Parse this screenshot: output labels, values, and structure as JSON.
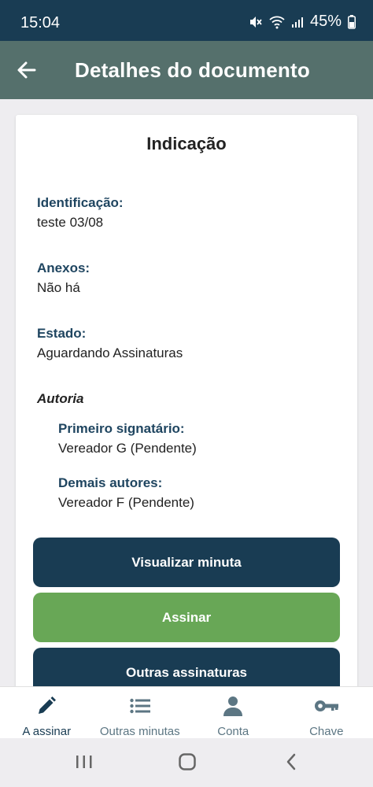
{
  "status_bar": {
    "time": "15:04",
    "battery": "45%"
  },
  "app_bar": {
    "title": "Detalhes do documento"
  },
  "document": {
    "title": "Indicação",
    "fields": [
      {
        "label": "Identificação:",
        "value": "teste 03/08"
      },
      {
        "label": "Anexos:",
        "value": "Não há"
      },
      {
        "label": "Estado:",
        "value": "Aguardando Assinaturas"
      }
    ],
    "authorship": {
      "title": "Autoria",
      "first_signer_label": "Primeiro signatário:",
      "first_signer_value": "Vereador G (Pendente)",
      "other_authors_label": "Demais autores:",
      "other_authors_value": "Vereador F (Pendente)"
    }
  },
  "actions": {
    "view_draft": "Visualizar minuta",
    "sign": "Assinar",
    "other_signatures": "Outras assinaturas"
  },
  "bottom_nav": [
    {
      "label": "A assinar",
      "icon": "pencil-icon",
      "active": true
    },
    {
      "label": "Outras minutas",
      "icon": "list-icon",
      "active": false
    },
    {
      "label": "Conta",
      "icon": "person-icon",
      "active": false
    },
    {
      "label": "Chave",
      "icon": "key-icon",
      "active": false
    }
  ],
  "colors": {
    "status_bar": "#193c53",
    "app_bar": "#55706c",
    "primary": "#193c53",
    "success": "#68a756",
    "label": "#1f4560"
  }
}
